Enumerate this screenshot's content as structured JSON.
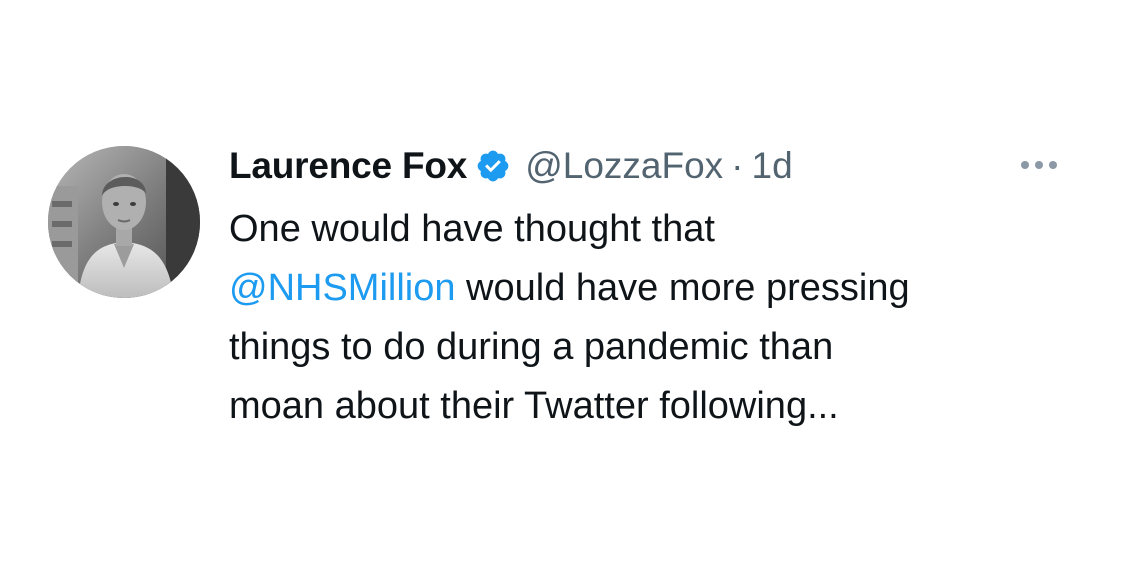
{
  "tweet": {
    "display_name": "Laurence Fox",
    "verified": true,
    "handle": "@LozzaFox",
    "separator": "·",
    "timestamp": "1d",
    "body_lines": [
      "One would have thought that",
      "@NHSMillion",
      " would have more pressing",
      "things to do during a pandemic than",
      "moan about their Twatter following..."
    ]
  },
  "icons": {
    "verified": "verified-badge-icon",
    "more": "more-options-icon",
    "avatar": "profile-photo"
  },
  "colors": {
    "text": "#0f1419",
    "secondary": "#536471",
    "mention": "#1d9bf0",
    "verified": "#1d9bf0"
  }
}
